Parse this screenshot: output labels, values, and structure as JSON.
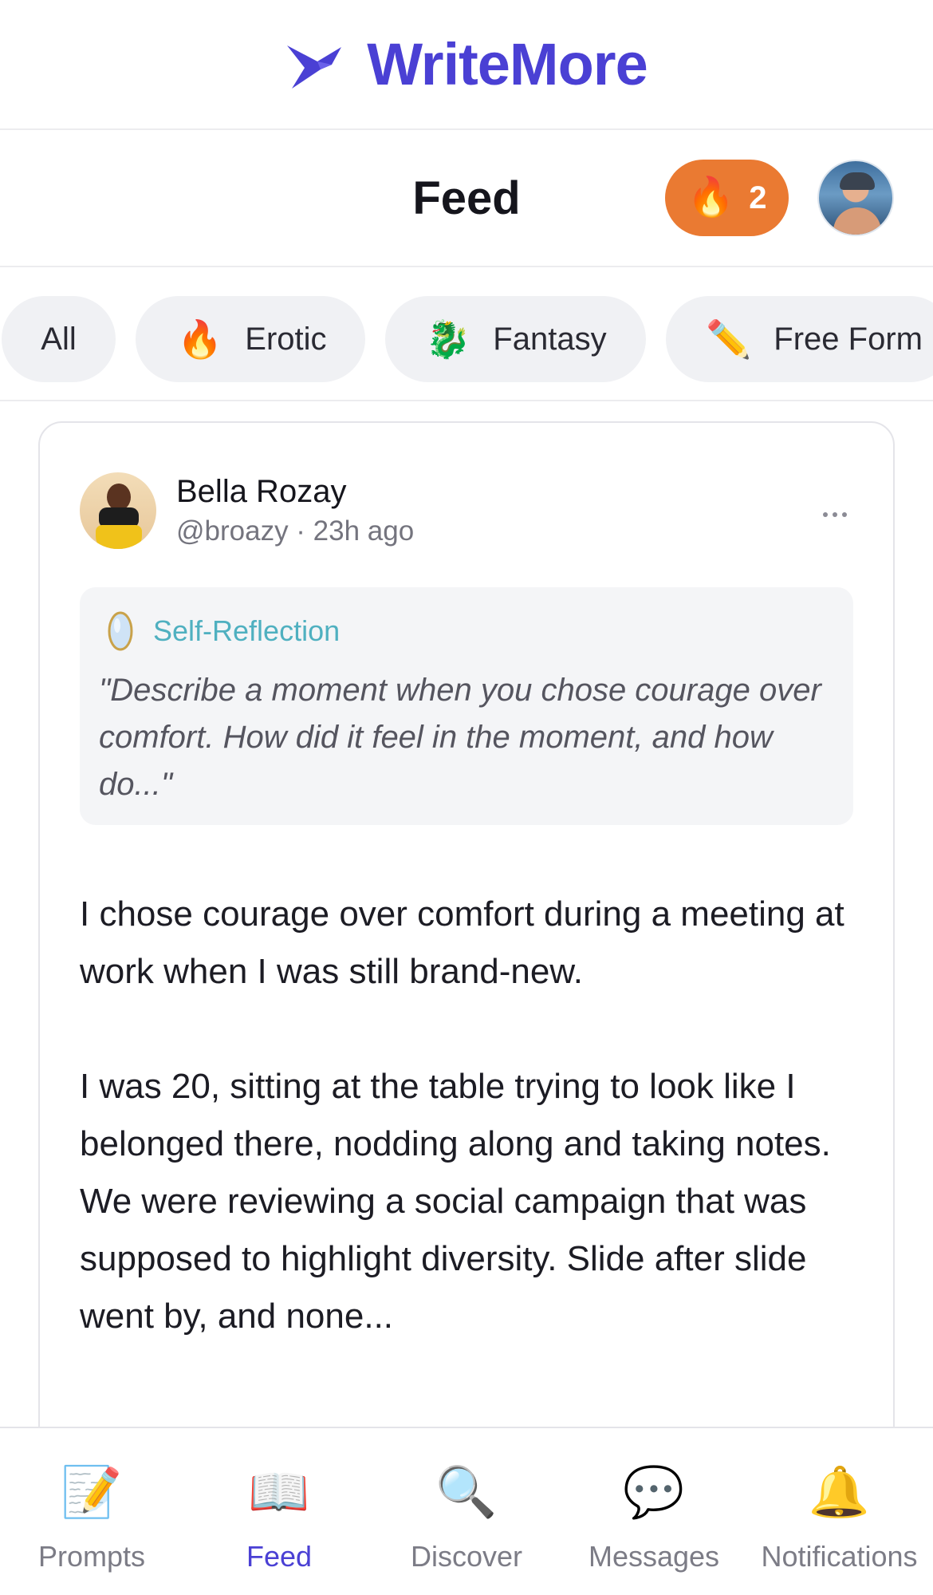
{
  "brand": {
    "name": "WriteMore",
    "color": "#4a40d4"
  },
  "header": {
    "title": "Feed",
    "streak_count": "2",
    "streak_icon": "🔥",
    "streak_color": "#ea7a32"
  },
  "categories": [
    {
      "label": "All",
      "icon": ""
    },
    {
      "label": "Erotic",
      "icon": "🔥"
    },
    {
      "label": "Fantasy",
      "icon": "🐉"
    },
    {
      "label": "Free Form",
      "icon": "✏️"
    }
  ],
  "post": {
    "author_name": "Bella Rozay",
    "author_meta": "@broazy · 23h ago",
    "prompt": {
      "category": "Self-Reflection",
      "category_color": "#4fb0c0",
      "text": "\"Describe a moment when you chose courage over comfort. How did it feel in the moment, and how do...\""
    },
    "body": [
      "I chose courage over comfort during a meeting at work when I was still brand-new.",
      "I was 20, sitting at the table trying to look like I belonged there, nodding along and taking notes. We were reviewing a social campaign that was supposed to highlight diversity. Slide after slide went by, and none..."
    ]
  },
  "tabs": [
    {
      "label": "Prompts",
      "icon": "📝",
      "active": false
    },
    {
      "label": "Feed",
      "icon": "📖",
      "active": true
    },
    {
      "label": "Discover",
      "icon": "🔍",
      "active": false
    },
    {
      "label": "Messages",
      "icon": "💬",
      "active": false
    },
    {
      "label": "Notifications",
      "icon": "🔔",
      "active": false
    }
  ]
}
